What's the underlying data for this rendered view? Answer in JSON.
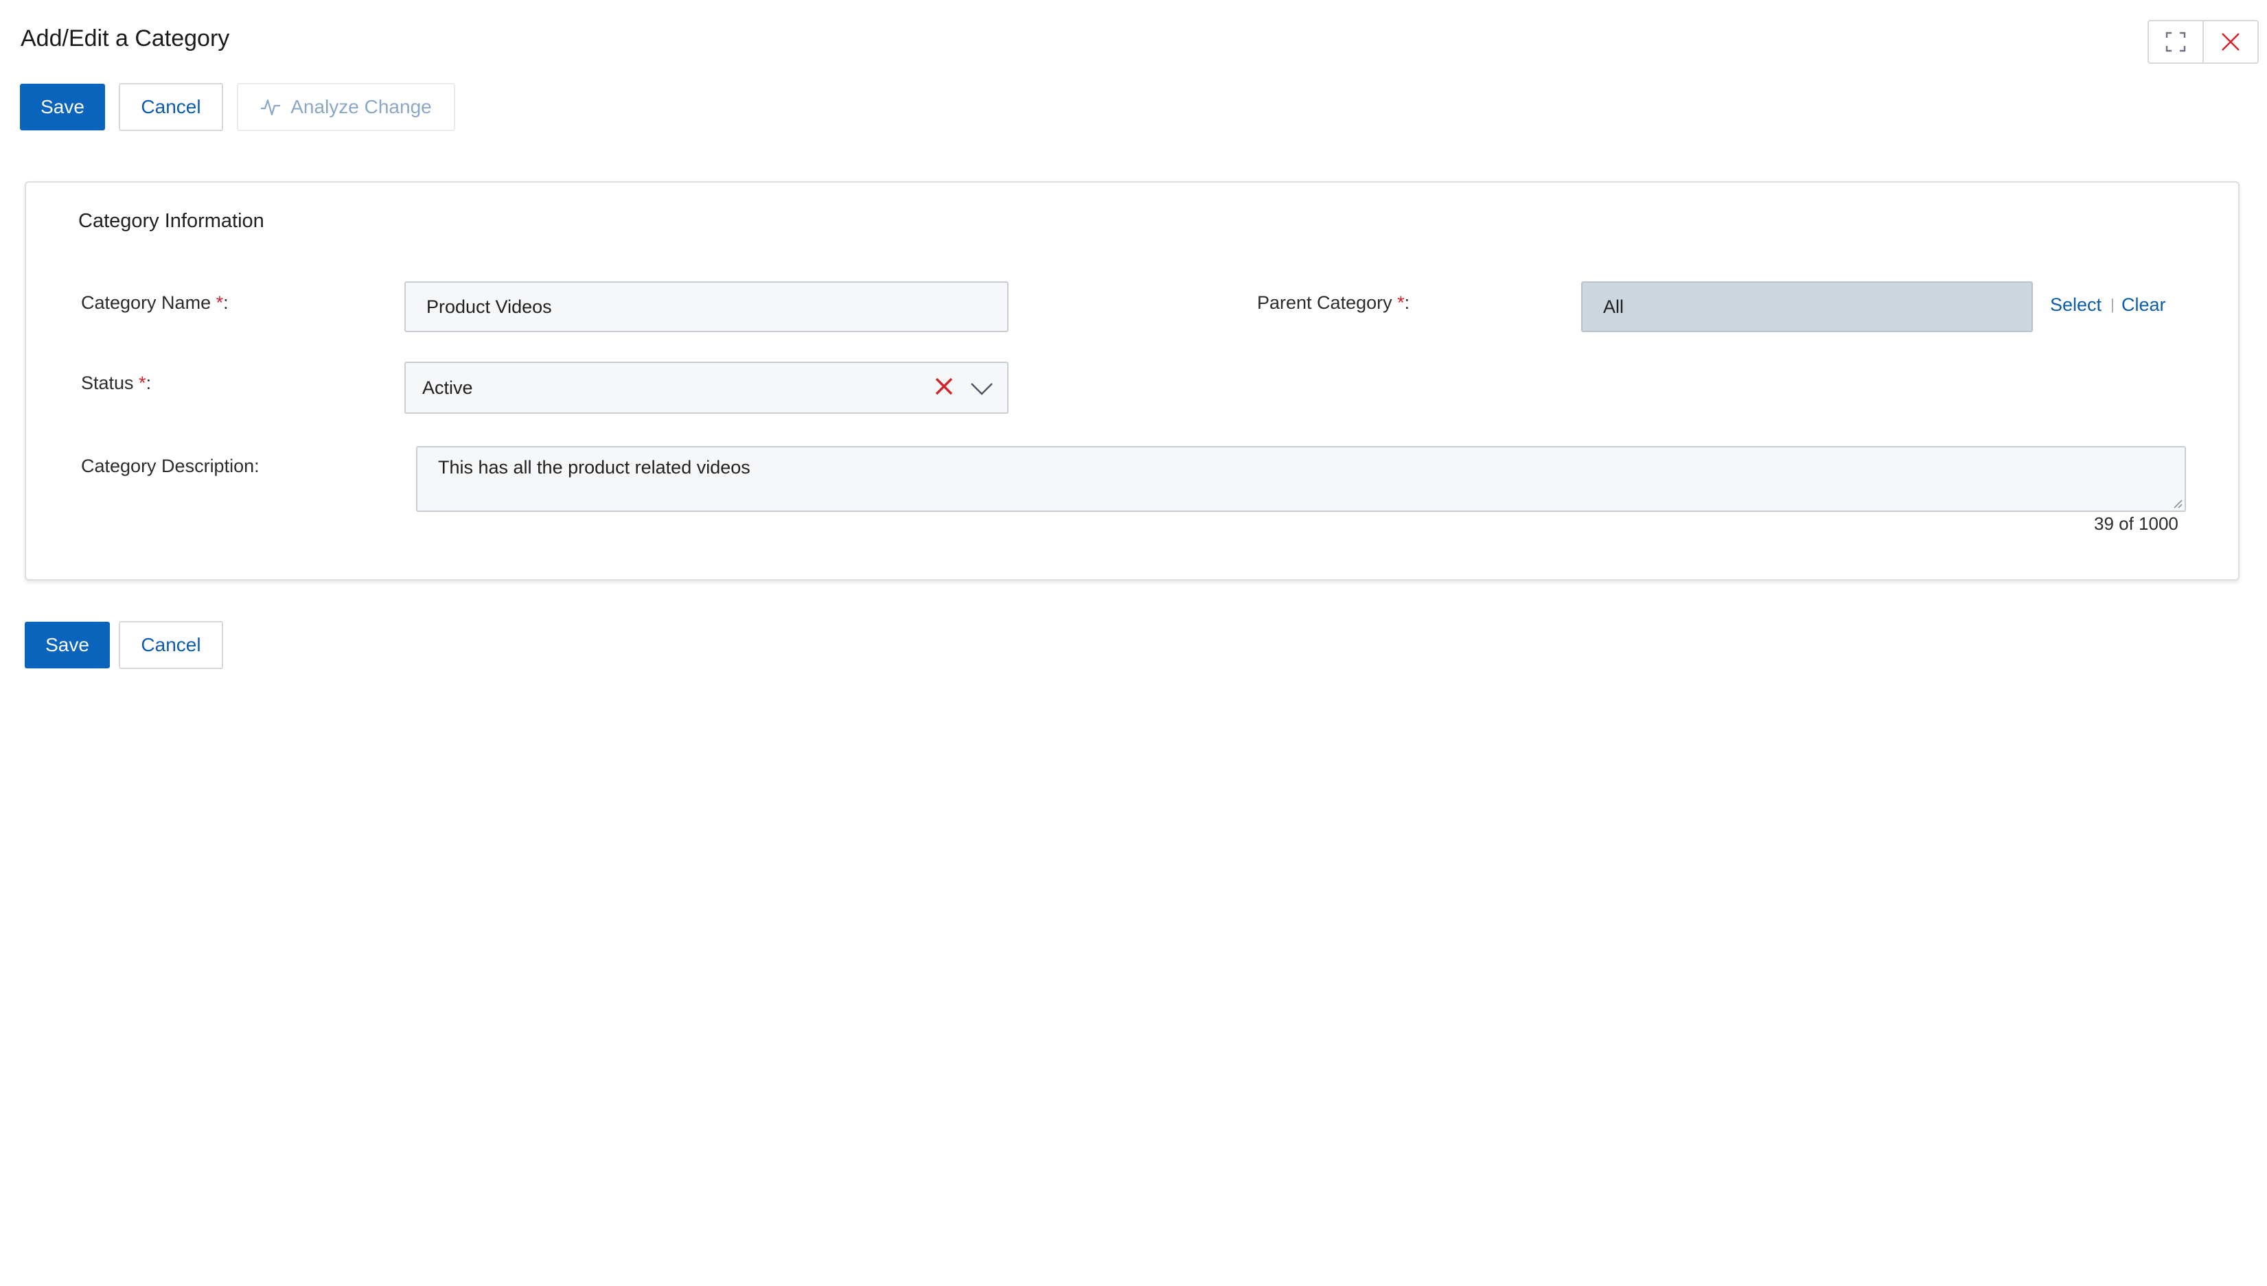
{
  "header": {
    "title": "Add/Edit a Category"
  },
  "toolbar_top": {
    "save_label": "Save",
    "cancel_label": "Cancel",
    "analyze_label": "Analyze Change"
  },
  "section": {
    "title": "Category Information"
  },
  "form": {
    "category_name": {
      "label": "Category Name ",
      "required_mark": "*",
      "colon": ":",
      "value": "Product Videos"
    },
    "parent_category": {
      "label": "Parent Category ",
      "required_mark": "*",
      "colon": ":",
      "value": "All",
      "select_label": "Select",
      "separator": "|",
      "clear_label": "Clear"
    },
    "status": {
      "label": "Status ",
      "required_mark": "*",
      "colon": ":",
      "value": "Active"
    },
    "description": {
      "label": "Category Description:",
      "value": "This has all the product related videos",
      "counter": "39 of 1000"
    }
  },
  "toolbar_bottom": {
    "save_label": "Save",
    "cancel_label": "Cancel"
  },
  "colors": {
    "primary": "#0a64bb",
    "link": "#0b5cad",
    "required": "#d4242b",
    "close_icon": "#d4242b"
  },
  "icons": [
    "expand-icon",
    "close-icon",
    "activity-icon",
    "clear-x-icon",
    "chevron-down-icon",
    "resize-grip-icon"
  ]
}
